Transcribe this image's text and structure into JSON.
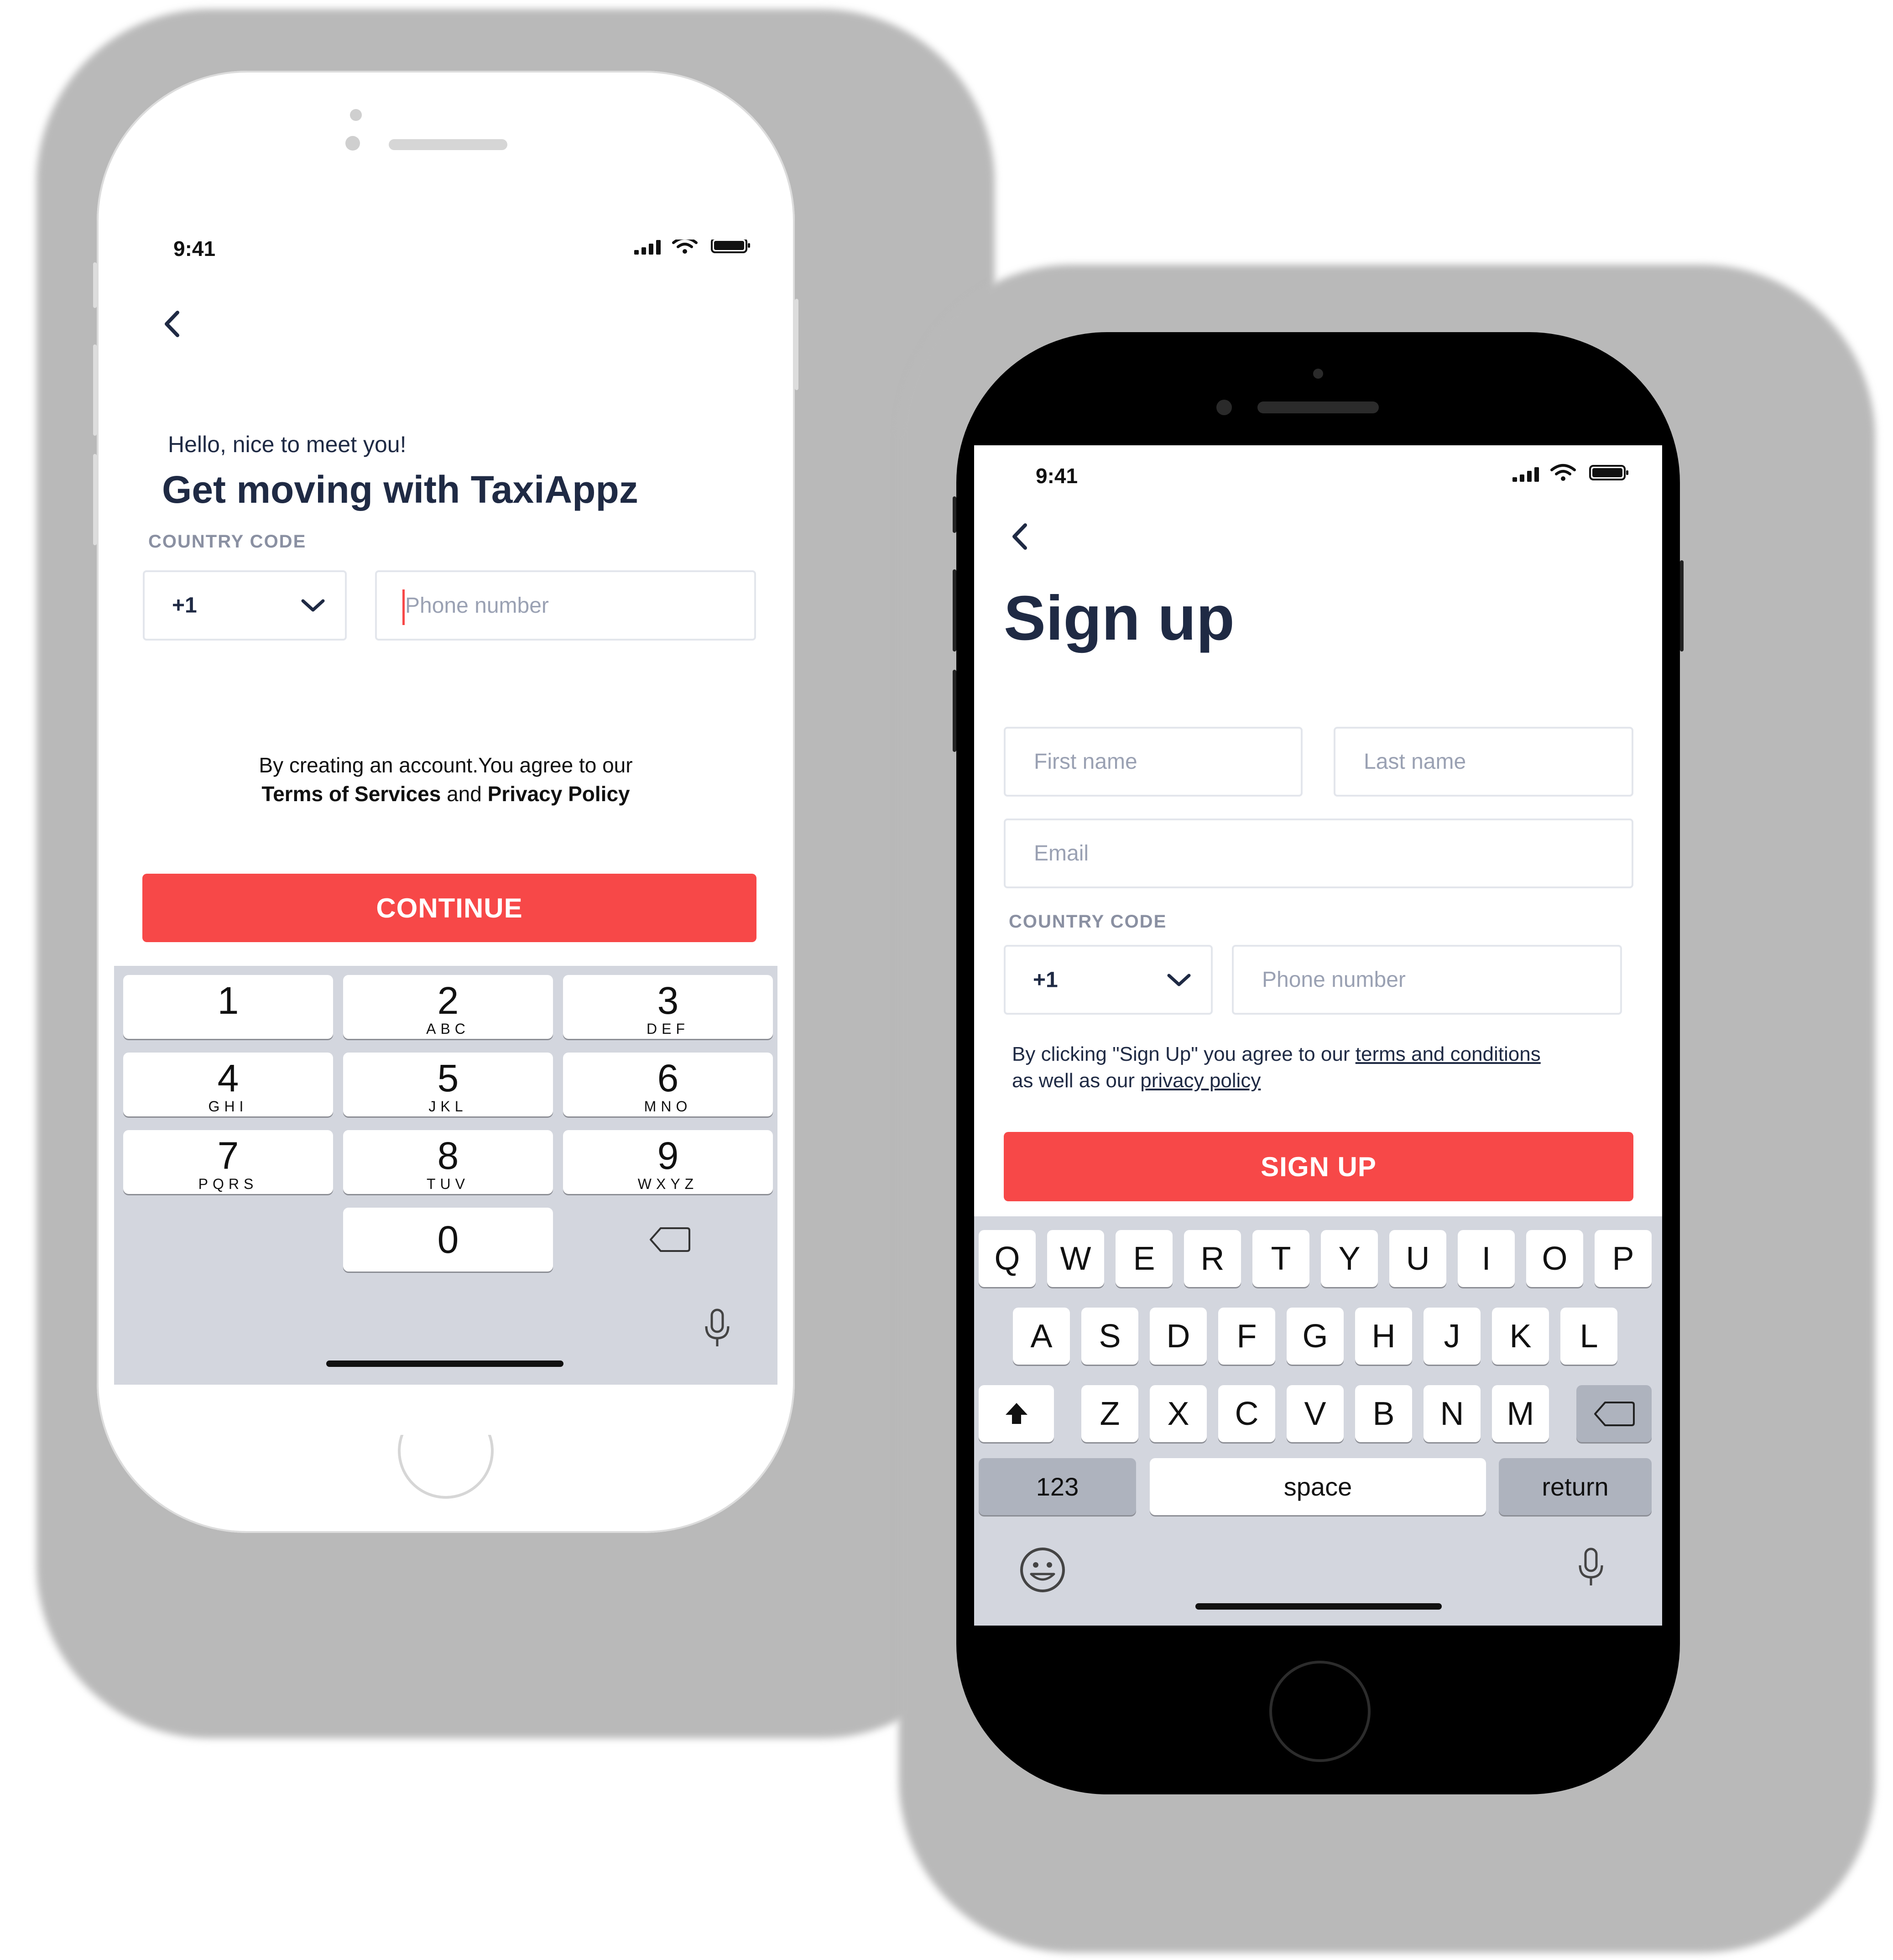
{
  "colors": {
    "accent": "#f74848",
    "navy": "#1f2a44",
    "placeholder": "#9aa1b3",
    "keypad_bg": "#d3d6de"
  },
  "left_phone": {
    "status": {
      "time": "9:41"
    },
    "back_icon": "chevron-left-icon",
    "greeting": "Hello, nice to meet you!",
    "title": "Get moving with TaxiAppz",
    "country_code_label": "COUNTRY CODE",
    "country_code_value": "+1",
    "phone_placeholder": "Phone number",
    "terms": {
      "line1": "By creating an account.You agree to our",
      "terms_link": "Terms of Services",
      "and": "and",
      "privacy_link": "Privacy Policy"
    },
    "continue_label": "CONTINUE",
    "keypad": [
      {
        "digit": "1",
        "letters": ""
      },
      {
        "digit": "2",
        "letters": "ABC"
      },
      {
        "digit": "3",
        "letters": "DEF"
      },
      {
        "digit": "4",
        "letters": "GHI"
      },
      {
        "digit": "5",
        "letters": "JKL"
      },
      {
        "digit": "6",
        "letters": "MNO"
      },
      {
        "digit": "7",
        "letters": "PQRS"
      },
      {
        "digit": "8",
        "letters": "TUV"
      },
      {
        "digit": "9",
        "letters": "WXYZ"
      },
      {
        "digit": "0",
        "letters": ""
      }
    ]
  },
  "right_phone": {
    "status": {
      "time": "9:41"
    },
    "title": "Sign up",
    "first_name_placeholder": "First name",
    "last_name_placeholder": "Last name",
    "email_placeholder": "Email",
    "country_code_label": "COUNTRY CODE",
    "country_code_value": "+1",
    "phone_placeholder": "Phone number",
    "agreement": {
      "prefix": "By clicking \"Sign Up\" you agree to our",
      "terms_link": "terms and conditions",
      "middle": "as well as our",
      "privacy_link": "privacy policy"
    },
    "signup_label": "SIGN UP",
    "keyboard": {
      "row1": [
        "Q",
        "W",
        "E",
        "R",
        "T",
        "Y",
        "U",
        "I",
        "O",
        "P"
      ],
      "row2": [
        "A",
        "S",
        "D",
        "F",
        "G",
        "H",
        "J",
        "K",
        "L"
      ],
      "row3": [
        "Z",
        "X",
        "C",
        "V",
        "B",
        "N",
        "M"
      ],
      "numbers_key": "123",
      "space_key": "space",
      "return_key": "return"
    }
  }
}
